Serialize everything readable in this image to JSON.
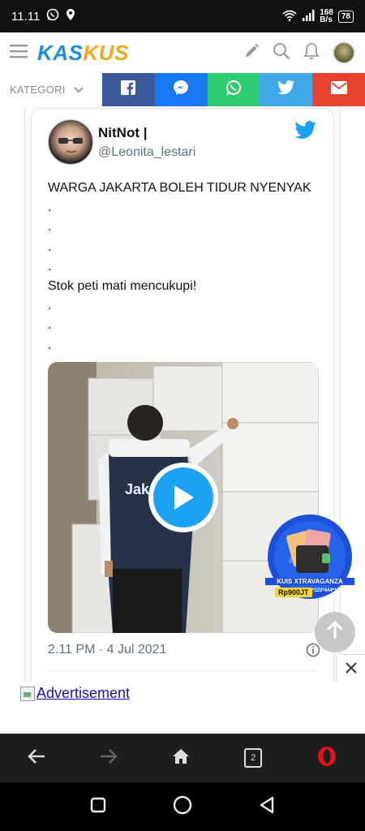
{
  "status_bar": {
    "time": "11.11",
    "net_speed_value": "168",
    "net_speed_unit": "B/s",
    "battery": "78"
  },
  "header": {
    "logo_part1": "KAS",
    "logo_part2": "KUS",
    "icons": [
      "menu-icon",
      "pencil-icon",
      "search-icon",
      "bell-icon",
      "user-avatar"
    ]
  },
  "share_bar": {
    "kategori_label": "KATEGORI",
    "buttons": [
      "facebook",
      "messenger",
      "whatsapp",
      "twitter",
      "email"
    ]
  },
  "tweet": {
    "name": "NitNot |",
    "handle": "@Leonita_lestari",
    "lines": [
      "WARGA JAKARTA BOLEH TIDUR NYENYAK",
      ".",
      ".",
      ".",
      ".",
      "Stok peti mati mencukupi!",
      ".",
      ".",
      "."
    ],
    "video_vest_text": "Jak",
    "timestamp": "2.11 PM · 4 Jul 2021"
  },
  "promo": {
    "title": "KUIS XTRAVAGANZA",
    "prize": "Rp900JT",
    "code": "*123*444*1#"
  },
  "ad": {
    "link_text": "Advertisement"
  },
  "browser_bar": {
    "tab_count": "2"
  },
  "colors": {
    "kaskus_blue": "#1a8ed8",
    "kaskus_orange": "#f7a51a",
    "twitter_blue": "#1da1f2",
    "facebook": "#3b5a9a",
    "messenger": "#1877f2",
    "whatsapp": "#2ecc71",
    "twitter_share": "#40a8e8",
    "email": "#e8432e",
    "opera_red": "#e0121b"
  }
}
